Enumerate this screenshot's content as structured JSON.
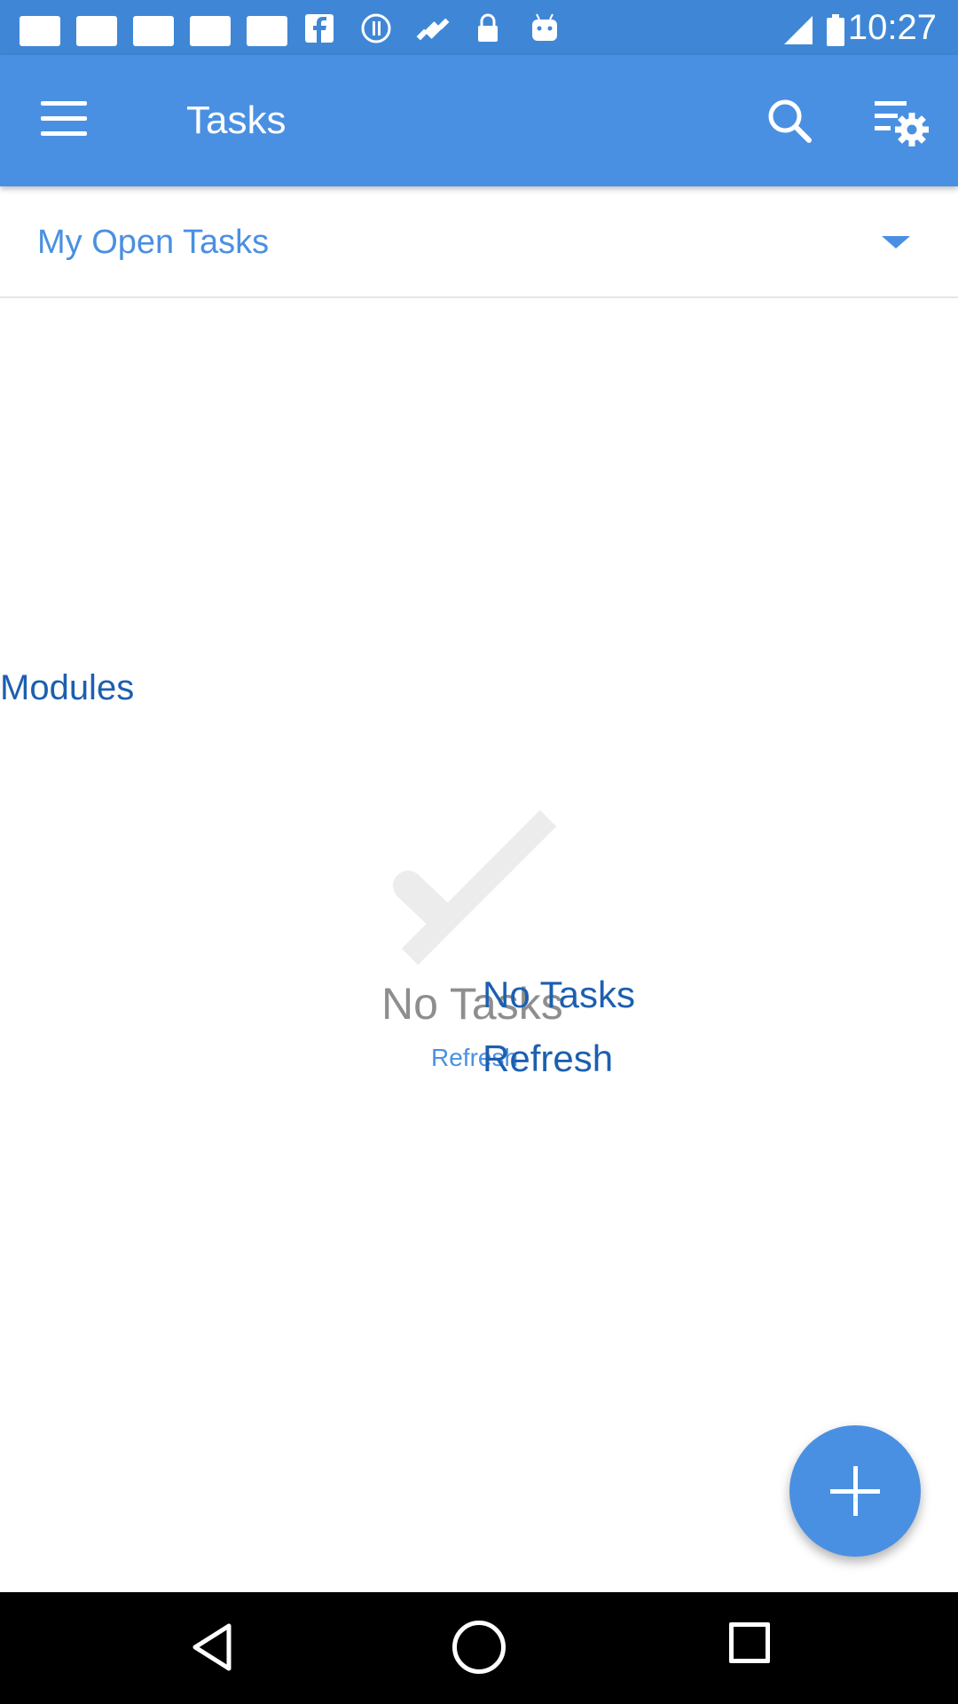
{
  "status_bar": {
    "time": "10:27",
    "icons": [
      "notification-square-icon",
      "notification-square-icon",
      "notification-square-icon",
      "notification-square-icon",
      "notification-square-icon",
      "facebook-icon",
      "info-icon",
      "fake-gps-icon",
      "lock-icon",
      "android-icon",
      "signal-icon",
      "battery-icon"
    ]
  },
  "app_bar": {
    "title": "Tasks",
    "color": "#4a90e2"
  },
  "filter": {
    "label": "My Open Tasks"
  },
  "modules": {
    "label": "Modules"
  },
  "empty_state": {
    "title": "No Tasks",
    "refresh_label": "Refresh"
  },
  "colors": {
    "accent": "#4a90e2",
    "dark_blue": "#1c5fb0",
    "status_bar": "#3f87d6"
  }
}
